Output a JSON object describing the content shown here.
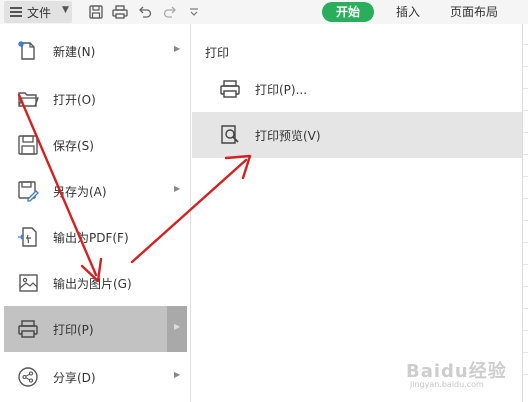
{
  "toolbar": {
    "file_label": "文件",
    "icons": [
      "save-icon",
      "print-icon",
      "undo-icon",
      "redo-icon",
      "customize-icon"
    ],
    "tabs": [
      {
        "label": "开始",
        "active": true
      },
      {
        "label": "插入",
        "active": false
      },
      {
        "label": "页面布局",
        "active": false
      }
    ],
    "accent_color": "#2bae5b"
  },
  "file_menu": {
    "items": [
      {
        "label": "新建(N)",
        "icon": "new-document-icon",
        "has_submenu": true
      },
      {
        "label": "打开(O)",
        "icon": "folder-open-icon",
        "has_submenu": false
      },
      {
        "label": "保存(S)",
        "icon": "save-icon",
        "has_submenu": false
      },
      {
        "label": "另存为(A)",
        "icon": "save-as-icon",
        "has_submenu": true
      },
      {
        "label": "输出为PDF(F)",
        "icon": "export-pdf-icon",
        "has_submenu": false
      },
      {
        "label": "输出为图片(G)",
        "icon": "export-image-icon",
        "has_submenu": false
      },
      {
        "label": "打印(P)",
        "icon": "printer-icon",
        "has_submenu": true,
        "active": true
      },
      {
        "label": "分享(D)",
        "icon": "share-icon",
        "has_submenu": true
      }
    ]
  },
  "print_submenu": {
    "title": "打印",
    "items": [
      {
        "label": "打印(P)...",
        "icon": "printer-icon"
      },
      {
        "label": "打印预览(V)",
        "icon": "print-preview-icon",
        "hover": true
      }
    ]
  },
  "annotation": {
    "arrow_color": "#d42020"
  },
  "watermark": {
    "text": "Baidu经验",
    "url": "jingyan.baidu.com"
  }
}
